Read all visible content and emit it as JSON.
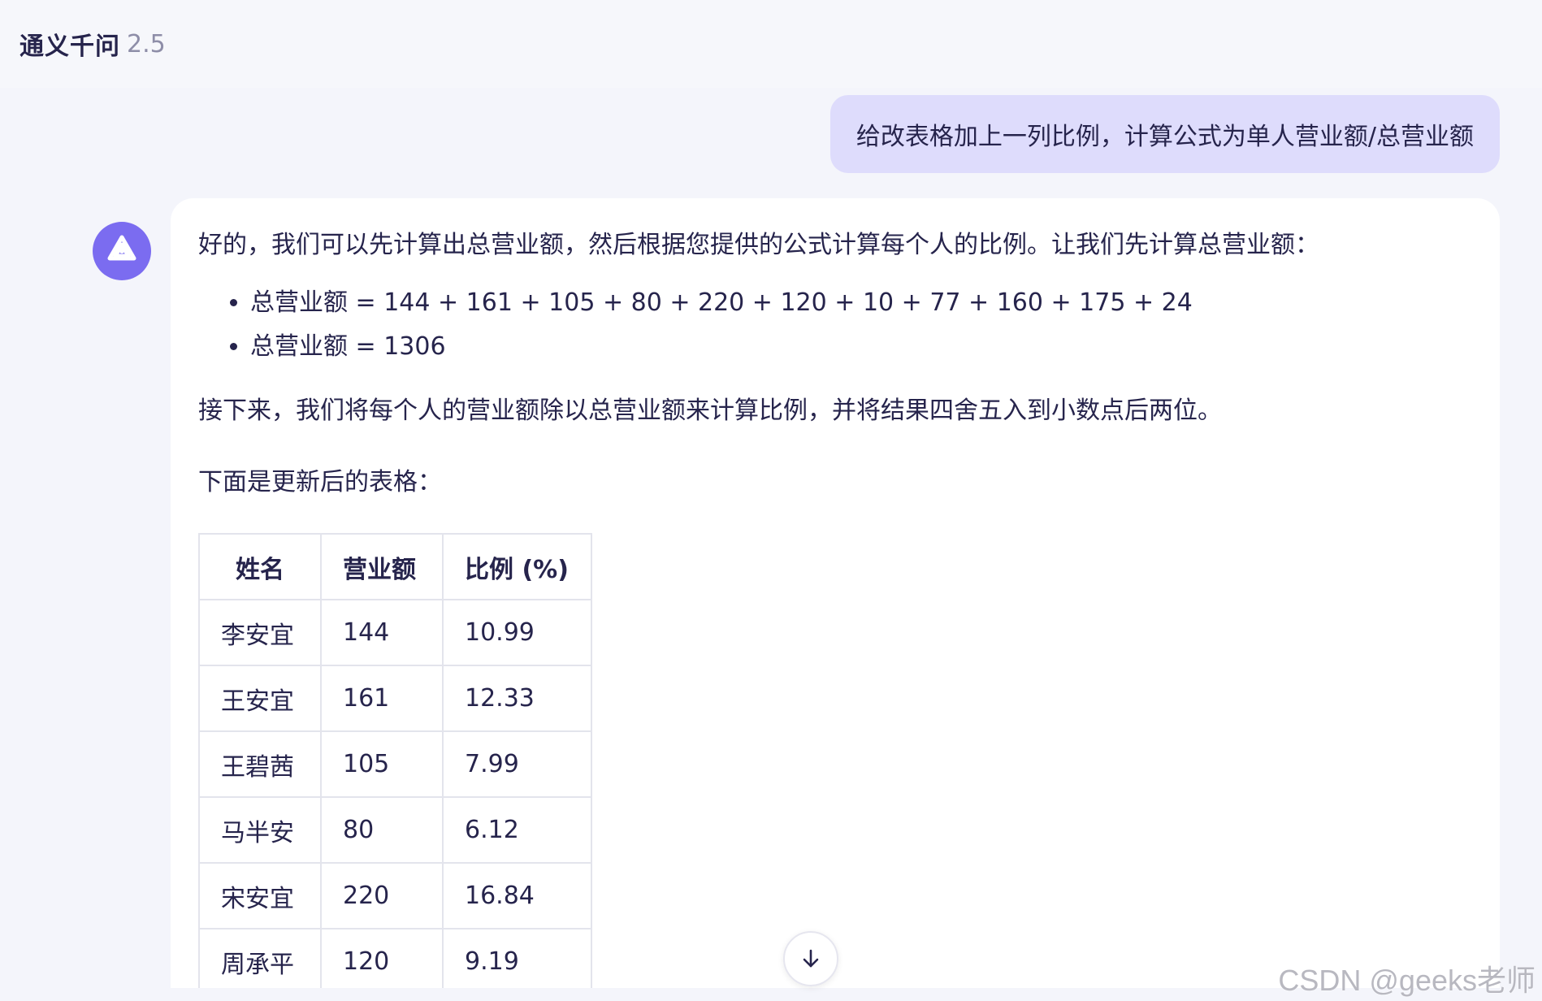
{
  "header": {
    "app_name": "通义千问",
    "version": "2.5"
  },
  "conversation": {
    "user_message": "给改表格加上一列比例，计算公式为单人营业额/总营业额",
    "assistant": {
      "intro": "好的，我们可以先计算出总营业额，然后根据您提供的公式计算每个人的比例。让我们先计算总营业额：",
      "bullets": [
        "总营业额 = 144 + 161 + 105 + 80 + 220 + 120 + 10 + 77 + 160 + 175 + 24",
        "总营业额 = 1306"
      ],
      "explanation": "接下来，我们将每个人的营业额除以总营业额来计算比例，并将结果四舍五入到小数点后两位。",
      "table_intro": "下面是更新后的表格：",
      "table": {
        "headers": [
          "姓名",
          "营业额",
          "比例 (%)"
        ],
        "rows": [
          [
            "李安宜",
            "144",
            "10.99"
          ],
          [
            "王安宜",
            "161",
            "12.33"
          ],
          [
            "王碧茜",
            "105",
            "7.99"
          ],
          [
            "马半安",
            "80",
            "6.12"
          ],
          [
            "宋安宜",
            "220",
            "16.84"
          ],
          [
            "周承平",
            "120",
            "9.19"
          ]
        ]
      }
    }
  },
  "watermark": "CSDN @geeks老师",
  "icons": {
    "avatar": "qwen-logo-icon",
    "scroll": "arrow-down-icon"
  },
  "colors": {
    "accent": "#7b6cf0",
    "user_bubble": "#dedcfc",
    "text": "#26244c",
    "background": "#f4f5fb"
  }
}
